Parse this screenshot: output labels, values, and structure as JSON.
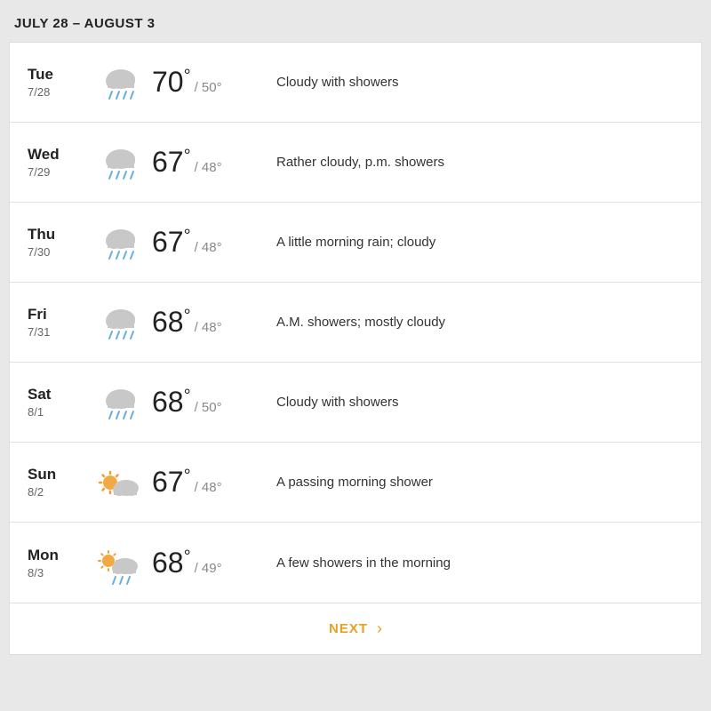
{
  "header": {
    "title": "JULY 28 – AUGUST 3"
  },
  "forecast": [
    {
      "day": "Tue",
      "date": "7/28",
      "icon": "cloud-rain",
      "high": "70",
      "low": "50",
      "description": "Cloudy with showers"
    },
    {
      "day": "Wed",
      "date": "7/29",
      "icon": "cloud-rain",
      "high": "67",
      "low": "48",
      "description": "Rather cloudy, p.m. showers"
    },
    {
      "day": "Thu",
      "date": "7/30",
      "icon": "cloud-rain",
      "high": "67",
      "low": "48",
      "description": "A little morning rain; cloudy"
    },
    {
      "day": "Fri",
      "date": "7/31",
      "icon": "cloud-rain",
      "high": "68",
      "low": "48",
      "description": "A.M. showers; mostly cloudy"
    },
    {
      "day": "Sat",
      "date": "8/1",
      "icon": "cloud-rain",
      "high": "68",
      "low": "50",
      "description": "Cloudy with showers"
    },
    {
      "day": "Sun",
      "date": "8/2",
      "icon": "sun-cloud",
      "high": "67",
      "low": "48",
      "description": "A passing morning shower"
    },
    {
      "day": "Mon",
      "date": "8/3",
      "icon": "sun-cloud-rain",
      "high": "68",
      "low": "49",
      "description": "A few showers in the morning"
    }
  ],
  "next_button": {
    "label": "NEXT"
  }
}
